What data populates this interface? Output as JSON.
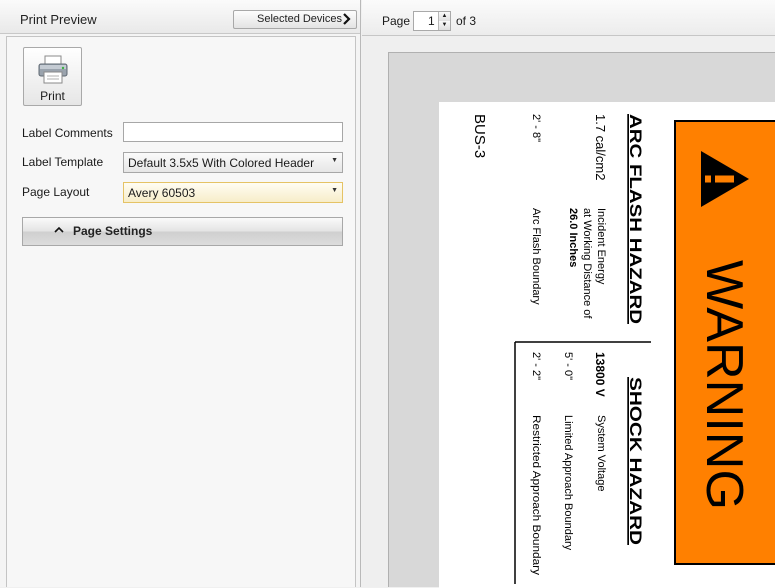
{
  "left_panel": {
    "title": "Print Preview",
    "selected_devices_label": "Selected Devices",
    "print_button_label": "Print",
    "label_comments": {
      "label": "Label Comments",
      "value": ""
    },
    "label_template": {
      "label": "Label Template",
      "value": "Default 3.5x5 With Colored Header"
    },
    "page_layout": {
      "label": "Page Layout",
      "value": "Avery 60503"
    },
    "page_settings_label": "Page Settings"
  },
  "preview_toolbar": {
    "page_label": "Page",
    "page_number": "1",
    "of_label": "of 3"
  },
  "label": {
    "header_text": "WARNING",
    "header_color": "#ff8000",
    "arc_flash_title": "ARC FLASH HAZARD",
    "incident_energy_value": "1.7 cal/cm2",
    "incident_energy_desc_1": "Incident Energy",
    "incident_energy_desc_2": "at Working Distance of",
    "working_distance": "26.0 Inches",
    "arc_flash_boundary_value": "2' - 8\"",
    "arc_flash_boundary_label": "Arc Flash Boundary",
    "shock_title": "SHOCK HAZARD",
    "system_voltage_value": "13800 V",
    "system_voltage_label": "System Voltage",
    "limited_approach_value": "5' - 0\"",
    "limited_approach_label": "Limited Approach Boundary",
    "restricted_approach_value": "2' - 2\"",
    "restricted_approach_label": "Restricted Approach Boundary",
    "equipment_name": "BUS-3"
  }
}
